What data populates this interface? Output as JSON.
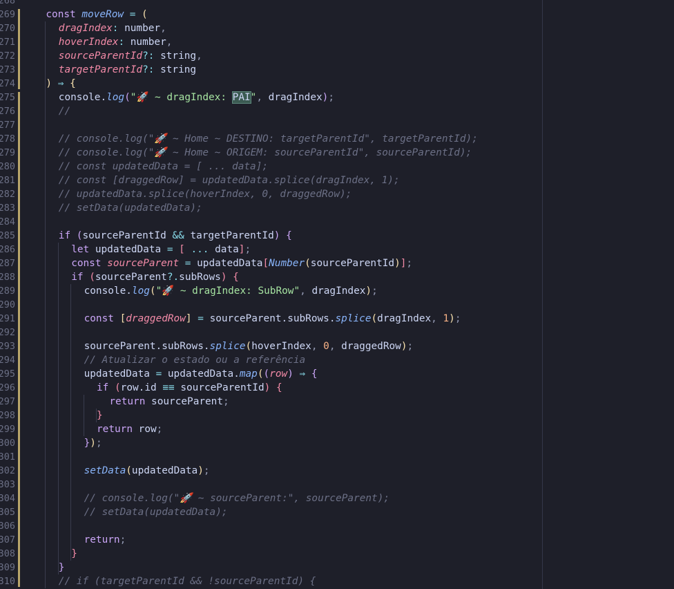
{
  "editor": {
    "first_line_number": 268,
    "lines": [
      {
        "indent": 0,
        "text": ""
      },
      {
        "indent": 1,
        "t": [
          [
            "kw",
            "const "
          ],
          [
            "fn",
            "moveRow"
          ],
          [
            "op",
            " = "
          ],
          [
            "pr1",
            "("
          ]
        ]
      },
      {
        "indent": 2,
        "t": [
          [
            "prm",
            "dragIndex"
          ],
          [
            "op",
            ": "
          ],
          [
            "",
            "number"
          ],
          [
            "pun",
            ","
          ]
        ]
      },
      {
        "indent": 2,
        "t": [
          [
            "prm",
            "hoverIndex"
          ],
          [
            "op",
            ": "
          ],
          [
            "",
            "number"
          ],
          [
            "pun",
            ","
          ]
        ]
      },
      {
        "indent": 2,
        "t": [
          [
            "prm",
            "sourceParentId"
          ],
          [
            "op",
            "?: "
          ],
          [
            "",
            "string"
          ],
          [
            "pun",
            ","
          ]
        ]
      },
      {
        "indent": 2,
        "t": [
          [
            "prm",
            "targetParentId"
          ],
          [
            "op",
            "?: "
          ],
          [
            "",
            "string"
          ]
        ]
      },
      {
        "indent": 1,
        "t": [
          [
            "pr1",
            ")"
          ],
          [
            "op",
            " ⇒ "
          ],
          [
            "pr1",
            "{"
          ]
        ]
      },
      {
        "indent": 2,
        "t": [
          [
            "",
            "console."
          ],
          [
            "fn",
            "log"
          ],
          [
            "pr2",
            "("
          ],
          [
            "str",
            "\"🚀 ~ dragIndex: "
          ],
          [
            "hl",
            "PAI"
          ],
          [
            "str",
            "\""
          ],
          [
            "pun",
            ", "
          ],
          [
            "",
            "dragIndex"
          ],
          [
            "pr2",
            ")"
          ],
          [
            "pun",
            ";"
          ]
        ]
      },
      {
        "indent": 2,
        "t": [
          [
            "cm",
            "//"
          ]
        ]
      },
      {
        "indent": 0,
        "text": ""
      },
      {
        "indent": 2,
        "t": [
          [
            "cm",
            "// console.log(\"🚀 ~ Home ~ DESTINO: targetParentId\", targetParentId);"
          ]
        ]
      },
      {
        "indent": 2,
        "t": [
          [
            "cm",
            "// console.log(\"🚀 ~ Home ~ ORIGEM: sourceParentId\", sourceParentId);"
          ]
        ]
      },
      {
        "indent": 2,
        "t": [
          [
            "cm",
            "// const updatedData = [ ... data];"
          ]
        ]
      },
      {
        "indent": 2,
        "t": [
          [
            "cm",
            "// const [draggedRow] = updatedData.splice(dragIndex, 1);"
          ]
        ]
      },
      {
        "indent": 2,
        "t": [
          [
            "cm",
            "// updatedData.splice(hoverIndex, 0, draggedRow);"
          ]
        ]
      },
      {
        "indent": 2,
        "t": [
          [
            "cm",
            "// setData(updatedData);"
          ]
        ]
      },
      {
        "indent": 0,
        "text": ""
      },
      {
        "indent": 2,
        "t": [
          [
            "kw",
            "if "
          ],
          [
            "pr2",
            "("
          ],
          [
            "",
            "sourceParentId "
          ],
          [
            "op",
            "&& "
          ],
          [
            "",
            "targetParentId"
          ],
          [
            "pr2",
            ")"
          ],
          [
            "pun",
            " "
          ],
          [
            "pr2",
            "{"
          ]
        ]
      },
      {
        "indent": 3,
        "t": [
          [
            "kw",
            "let "
          ],
          [
            "",
            "updatedData "
          ],
          [
            "op",
            "= "
          ],
          [
            "pr3",
            "["
          ],
          [
            "op",
            " ... "
          ],
          [
            "",
            "data"
          ],
          [
            "pr3",
            "]"
          ],
          [
            "pun",
            ";"
          ]
        ]
      },
      {
        "indent": 3,
        "t": [
          [
            "kw",
            "const "
          ],
          [
            "var",
            "sourceParent"
          ],
          [
            "op",
            " = "
          ],
          [
            "",
            "updatedData"
          ],
          [
            "pr3",
            "["
          ],
          [
            "fn",
            "Number"
          ],
          [
            "pr1",
            "("
          ],
          [
            "",
            "sourceParentId"
          ],
          [
            "pr1",
            ")"
          ],
          [
            "pr3",
            "]"
          ],
          [
            "pun",
            ";"
          ]
        ]
      },
      {
        "indent": 3,
        "t": [
          [
            "kw",
            "if "
          ],
          [
            "pr3",
            "("
          ],
          [
            "",
            "sourceParent"
          ],
          [
            "op",
            "?."
          ],
          [
            "",
            "subRows"
          ],
          [
            "pr3",
            ")"
          ],
          [
            "pun",
            " "
          ],
          [
            "pr3",
            "{"
          ]
        ]
      },
      {
        "indent": 4,
        "t": [
          [
            "",
            "console."
          ],
          [
            "fn",
            "log"
          ],
          [
            "pr1",
            "("
          ],
          [
            "str",
            "\"🚀 ~ dragIndex: SubRow\""
          ],
          [
            "pun",
            ", "
          ],
          [
            "",
            "dragIndex"
          ],
          [
            "pr1",
            ")"
          ],
          [
            "pun",
            ";"
          ]
        ]
      },
      {
        "indent": 0,
        "text": ""
      },
      {
        "indent": 4,
        "t": [
          [
            "kw",
            "const "
          ],
          [
            "pr1",
            "["
          ],
          [
            "var",
            "draggedRow"
          ],
          [
            "pr1",
            "]"
          ],
          [
            "op",
            " = "
          ],
          [
            "",
            "sourceParent.subRows."
          ],
          [
            "fn",
            "splice"
          ],
          [
            "pr1",
            "("
          ],
          [
            "",
            "dragIndex"
          ],
          [
            "pun",
            ", "
          ],
          [
            "num",
            "1"
          ],
          [
            "pr1",
            ")"
          ],
          [
            "pun",
            ";"
          ]
        ]
      },
      {
        "indent": 0,
        "text": ""
      },
      {
        "indent": 4,
        "t": [
          [
            "",
            "sourceParent.subRows."
          ],
          [
            "fn",
            "splice"
          ],
          [
            "pr1",
            "("
          ],
          [
            "",
            "hoverIndex"
          ],
          [
            "pun",
            ", "
          ],
          [
            "num",
            "0"
          ],
          [
            "pun",
            ", "
          ],
          [
            "",
            "draggedRow"
          ],
          [
            "pr1",
            ")"
          ],
          [
            "pun",
            ";"
          ]
        ]
      },
      {
        "indent": 4,
        "t": [
          [
            "cm",
            "// Atualizar o estado ou a referência"
          ]
        ]
      },
      {
        "indent": 4,
        "t": [
          [
            "",
            "updatedData "
          ],
          [
            "op",
            "= "
          ],
          [
            "",
            "updatedData."
          ],
          [
            "fn",
            "map"
          ],
          [
            "pr1",
            "("
          ],
          [
            "pr2",
            "("
          ],
          [
            "prm",
            "row"
          ],
          [
            "pr2",
            ")"
          ],
          [
            "op",
            " ⇒ "
          ],
          [
            "pr2",
            "{"
          ]
        ]
      },
      {
        "indent": 5,
        "t": [
          [
            "kw",
            "if "
          ],
          [
            "pr3",
            "("
          ],
          [
            "",
            "row.id "
          ],
          [
            "op",
            "≡≡ "
          ],
          [
            "",
            "sourceParentId"
          ],
          [
            "pr3",
            ")"
          ],
          [
            "pun",
            " "
          ],
          [
            "pr3",
            "{"
          ]
        ]
      },
      {
        "indent": 6,
        "t": [
          [
            "kw",
            "return "
          ],
          [
            "",
            "sourceParent"
          ],
          [
            "pun",
            ";"
          ]
        ]
      },
      {
        "indent": 5,
        "t": [
          [
            "pr3",
            "}"
          ]
        ]
      },
      {
        "indent": 5,
        "t": [
          [
            "kw",
            "return "
          ],
          [
            "",
            "row"
          ],
          [
            "pun",
            ";"
          ]
        ]
      },
      {
        "indent": 4,
        "t": [
          [
            "pr2",
            "}"
          ],
          [
            "pr1",
            ")"
          ],
          [
            "pun",
            ";"
          ]
        ]
      },
      {
        "indent": 0,
        "text": ""
      },
      {
        "indent": 4,
        "t": [
          [
            "fn",
            "setData"
          ],
          [
            "pr1",
            "("
          ],
          [
            "",
            "updatedData"
          ],
          [
            "pr1",
            ")"
          ],
          [
            "pun",
            ";"
          ]
        ]
      },
      {
        "indent": 0,
        "text": ""
      },
      {
        "indent": 4,
        "t": [
          [
            "cm",
            "// console.log(\"🚀 ~ sourceParent:\", sourceParent);"
          ]
        ]
      },
      {
        "indent": 4,
        "t": [
          [
            "cm",
            "// setData(updatedData);"
          ]
        ]
      },
      {
        "indent": 0,
        "text": ""
      },
      {
        "indent": 4,
        "t": [
          [
            "kw",
            "return"
          ],
          [
            "pun",
            ";"
          ]
        ]
      },
      {
        "indent": 3,
        "t": [
          [
            "pr3",
            "}"
          ]
        ]
      },
      {
        "indent": 2,
        "t": [
          [
            "pr2",
            "}"
          ]
        ]
      },
      {
        "indent": 2,
        "t": [
          [
            "cm",
            "// if (targetParentId && !sourceParentId) {"
          ]
        ]
      }
    ]
  },
  "colors": {
    "background": "#1e1f29",
    "line_number": "#6c7086",
    "git_modified": "#b9a66b"
  }
}
